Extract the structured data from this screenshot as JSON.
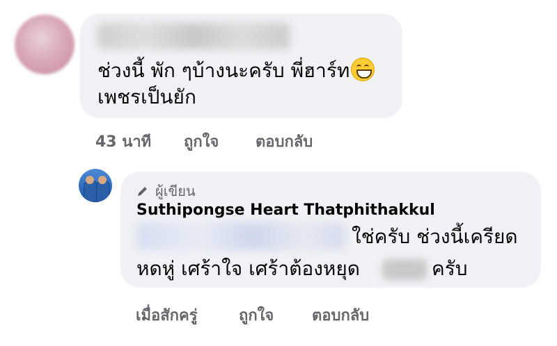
{
  "comment": {
    "text_line1": "ช่วงนี้ พัก ๆบ้างนะครับ พี่ฮาร์ท",
    "emoji_icon": "grinning-face-emoji",
    "text_line2": "เพชรเป็นยัก",
    "actions": {
      "time": "43 นาที",
      "like": "ถูกใจ",
      "reply": "ตอบกลับ"
    }
  },
  "reply": {
    "author_badge": "ผู้เขียน",
    "author_badge_icon": "pen-icon",
    "commenter_name": "Suthipongse Heart Thatphithakkul",
    "text_line1": "ใช่ครับ ช่วงนี้เครียด",
    "text_line2_part1": "หดหู่ เศร้าใจ  เศร้าต้องหยุด",
    "text_line2_part2": "ครับ",
    "actions": {
      "time": "เมื่อสักครู่",
      "like": "ถูกใจ",
      "reply": "ตอบกลับ"
    }
  }
}
